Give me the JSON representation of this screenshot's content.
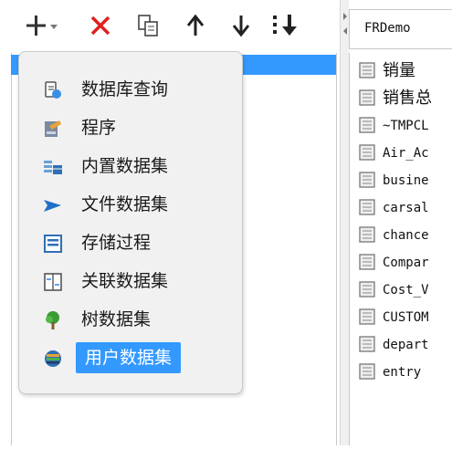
{
  "menu": {
    "items": [
      {
        "label": "数据库查询",
        "icon": "database-query-icon"
      },
      {
        "label": "程序",
        "icon": "program-icon"
      },
      {
        "label": "内置数据集",
        "icon": "builtin-dataset-icon"
      },
      {
        "label": "文件数据集",
        "icon": "file-dataset-icon"
      },
      {
        "label": "存储过程",
        "icon": "stored-procedure-icon"
      },
      {
        "label": "关联数据集",
        "icon": "related-dataset-icon"
      },
      {
        "label": "树数据集",
        "icon": "tree-dataset-icon"
      },
      {
        "label": "用户数据集",
        "icon": "user-dataset-icon",
        "selected": true
      }
    ]
  },
  "right_panel": {
    "connection": "FRDemo",
    "tables": [
      "销量",
      "销售总",
      "~TMPCL",
      "Air_Ac",
      "busine",
      "carsal",
      "chance",
      "Compar",
      "Cost_V",
      "CUSTOM",
      "depart",
      "entry"
    ]
  },
  "colors": {
    "accent": "#3399ff",
    "delete": "#e02020",
    "menu_bg": "#f1f1f1"
  }
}
